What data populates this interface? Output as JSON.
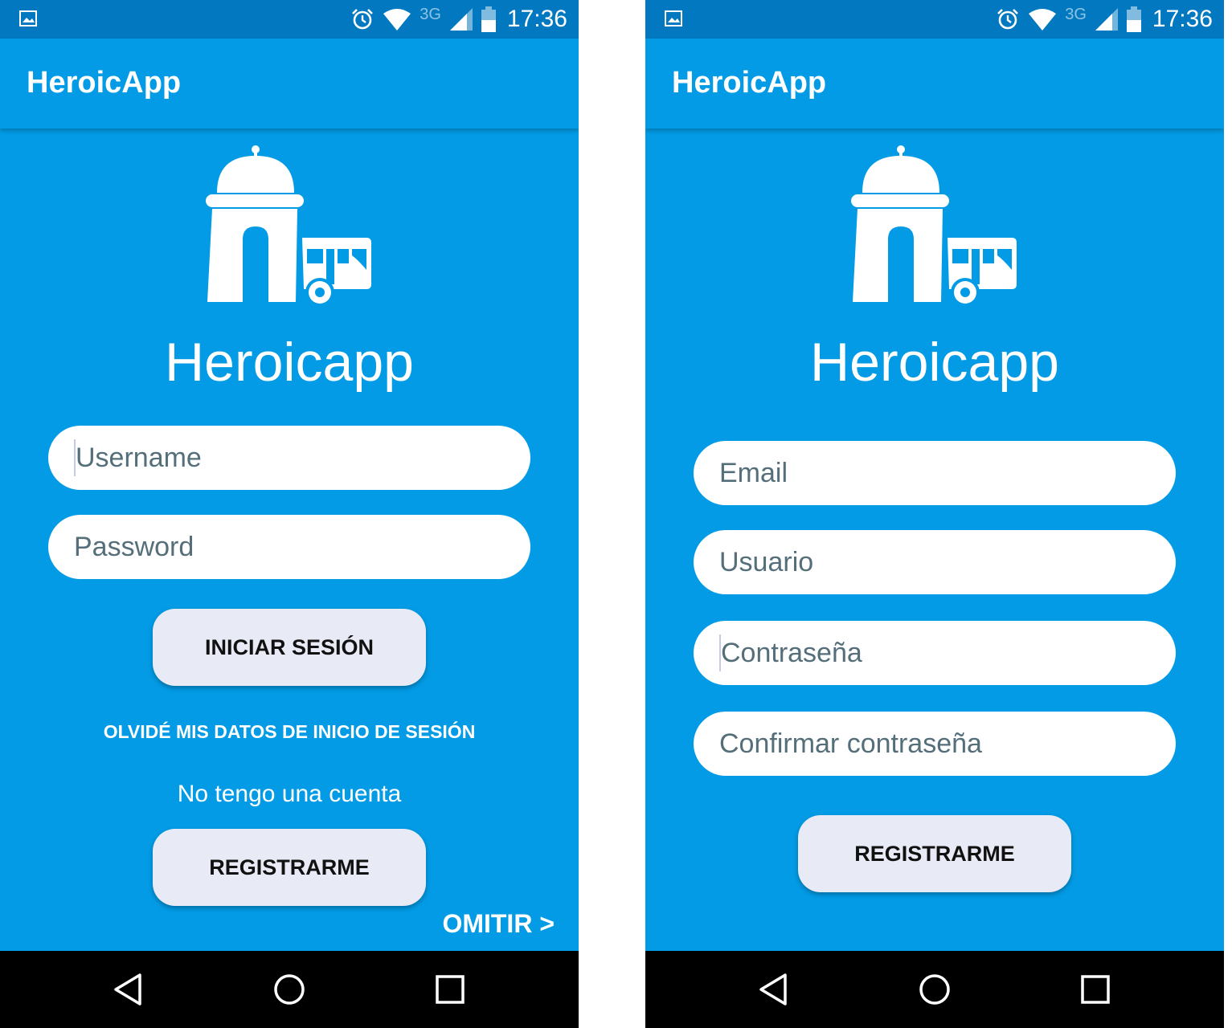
{
  "status_bar": {
    "time": "17:36",
    "network": "3G"
  },
  "colors": {
    "primary": "#039be5",
    "status_bar": "#0278c0",
    "button": "#e8eaf6",
    "placeholder": "#546e7a"
  },
  "login": {
    "app_title": "HeroicApp",
    "brand": "Heroicapp",
    "username_placeholder": "Username",
    "password_placeholder": "Password",
    "login_button": "INICIAR SESIÓN",
    "forgot_link": "OLVIDÉ MIS DATOS DE INICIO DE SESIÓN",
    "no_account_text": "No tengo una cuenta",
    "register_button": "REGISTRARME",
    "skip_link": "OMITIR >"
  },
  "register": {
    "app_title": "HeroicApp",
    "brand": "Heroicapp",
    "email_placeholder": "Email",
    "user_placeholder": "Usuario",
    "password_placeholder": "Contraseña",
    "confirm_placeholder": "Confirmar contraseña",
    "register_button": "REGISTRARME"
  },
  "icons": {
    "status": [
      "image-icon",
      "alarm-icon",
      "wifi-icon",
      "signal-icon",
      "battery-icon"
    ],
    "nav": [
      "back-icon",
      "home-icon",
      "recents-icon"
    ],
    "logo": "gate-bus-logo-icon"
  }
}
